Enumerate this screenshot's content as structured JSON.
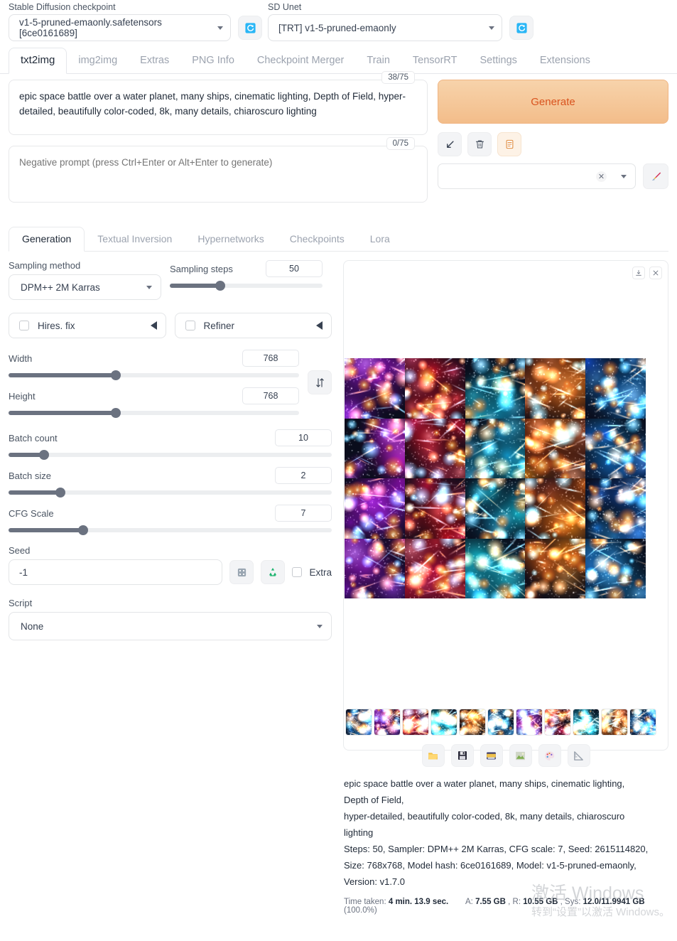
{
  "header": {
    "checkpoint_label": "Stable Diffusion checkpoint",
    "checkpoint_value": "v1-5-pruned-emaonly.safetensors [6ce0161689]",
    "unet_label": "SD Unet",
    "unet_value": "[TRT] v1-5-pruned-emaonly",
    "refresh_icon": "refresh-icon"
  },
  "tabs": [
    {
      "label": "txt2img",
      "active": true
    },
    {
      "label": "img2img",
      "active": false
    },
    {
      "label": "Extras",
      "active": false
    },
    {
      "label": "PNG Info",
      "active": false
    },
    {
      "label": "Checkpoint Merger",
      "active": false
    },
    {
      "label": "Train",
      "active": false
    },
    {
      "label": "TensorRT",
      "active": false
    },
    {
      "label": "Settings",
      "active": false
    },
    {
      "label": "Extensions",
      "active": false
    }
  ],
  "prompt": {
    "positive_value": "epic space battle over a water planet, many ships, cinematic lighting, Depth of Field, hyper-detailed, beautifully color-coded, 8k, many details, chiaroscuro lighting",
    "positive_counter": "38/75",
    "negative_placeholder": "Negative prompt (press Ctrl+Enter or Alt+Enter to generate)",
    "negative_value": "",
    "negative_counter": "0/75"
  },
  "actions": {
    "generate_label": "Generate",
    "generate_bg": "#f3bd8a",
    "generate_text_color": "#d9531e",
    "buttons": [
      {
        "name": "restore-progress-icon",
        "glyph": "↙"
      },
      {
        "name": "clear-prompt-icon",
        "glyph": "🗑"
      },
      {
        "name": "apply-style-icon",
        "glyph": "📋"
      }
    ],
    "styles_placeholder": "",
    "clear_styles_glyph": "✕",
    "paint_icon": "paintbrush-icon"
  },
  "subtabs": [
    {
      "label": "Generation",
      "active": true
    },
    {
      "label": "Textual Inversion",
      "active": false
    },
    {
      "label": "Hypernetworks",
      "active": false
    },
    {
      "label": "Checkpoints",
      "active": false
    },
    {
      "label": "Lora",
      "active": false
    }
  ],
  "params": {
    "sampling_method_label": "Sampling method",
    "sampling_method_value": "DPM++ 2M Karras",
    "sampling_steps_label": "Sampling steps",
    "sampling_steps_value": "50",
    "sampling_steps_pct": 33,
    "hires_label": "Hires. fix",
    "refiner_label": "Refiner",
    "width_label": "Width",
    "width_value": "768",
    "width_pct": 37,
    "height_label": "Height",
    "height_value": "768",
    "height_pct": 37,
    "batch_count_label": "Batch count",
    "batch_count_value": "10",
    "batch_count_pct": 11,
    "batch_size_label": "Batch size",
    "batch_size_value": "2",
    "batch_size_pct": 16,
    "cfg_label": "CFG Scale",
    "cfg_value": "7",
    "cfg_pct": 23,
    "seed_label": "Seed",
    "seed_value": "-1",
    "extra_label": "Extra",
    "script_label": "Script",
    "script_value": "None",
    "swap_icon": "swap-dimensions-icon",
    "dice_icon": "random-seed-icon",
    "recycle_icon": "reuse-seed-icon"
  },
  "gallery": {
    "download_icon": "download-icon",
    "close_icon": "close-icon",
    "grid_rows": 4,
    "grid_cols": 5,
    "thumb_count": 11,
    "tools": [
      {
        "name": "open-folder-icon",
        "glyph": "📁"
      },
      {
        "name": "save-icon",
        "glyph": "💾"
      },
      {
        "name": "zip-icon",
        "glyph": "🗃"
      },
      {
        "name": "send-to-img2img-icon",
        "glyph": "🖼"
      },
      {
        "name": "send-to-extras-icon",
        "glyph": "🎨"
      },
      {
        "name": "send-to-inpaint-icon",
        "glyph": "📐"
      }
    ]
  },
  "infotext": {
    "line1": "epic space battle over a water planet, many ships, cinematic lighting,",
    "line2": "Depth of Field,",
    "line3": "hyper-detailed, beautifully color-coded, 8k, many details, chiaroscuro",
    "line4": "lighting",
    "line5": "Steps: 50, Sampler: DPM++ 2M Karras, CFG scale: 7, Seed: 2615114820,",
    "line6": "Size: 768x768, Model hash: 6ce0161689, Model: v1-5-pruned-emaonly,",
    "line7": "Version: v1.7.0"
  },
  "status": {
    "time_label": "Time taken:",
    "time_value": "4 min. 13.9 sec.",
    "a_label": "A:",
    "a_value": "7.55 GB",
    "r_label": ", R:",
    "r_value": "10.55 GB",
    "sys_label": ", Sys:",
    "sys_value": "12.0/11.9941 GB",
    "sys_pct": "(100.0%)"
  },
  "watermark": {
    "line1": "激活 Windows",
    "line2": "转到“设置”以激活 Windows。"
  }
}
